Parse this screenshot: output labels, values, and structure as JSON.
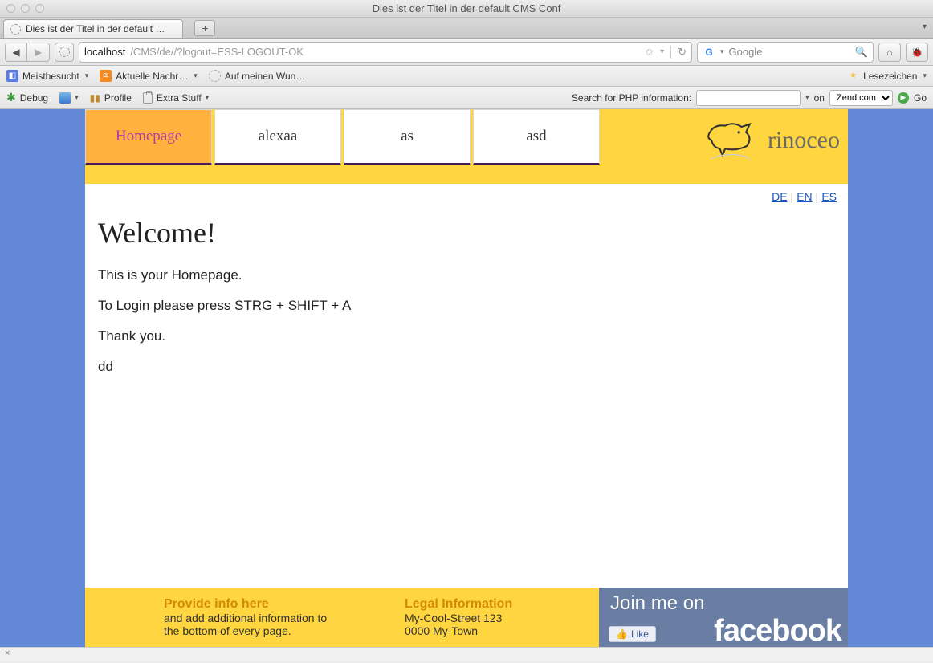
{
  "window": {
    "title": "Dies ist der Titel in der default CMS Conf"
  },
  "tab": {
    "title": "Dies ist der Titel in der default …"
  },
  "url": {
    "host": "localhost",
    "path": "/CMS/de//?logout=ESS-LOGOUT-OK"
  },
  "search": {
    "placeholder": "Google"
  },
  "bookmarks": {
    "most_visited": "Meistbesucht",
    "news": "Aktuelle Nachr…",
    "wishlist": "Auf meinen Wun…",
    "bookmarks_btn": "Lesezeichen"
  },
  "devbar": {
    "debug": "Debug",
    "profile": "Profile",
    "extra": "Extra Stuff",
    "search_label": "Search for PHP information:",
    "on_label": "on",
    "site_select": "Zend.com",
    "go": "Go"
  },
  "nav": {
    "items": [
      "Homepage",
      "alexaa",
      "as",
      "asd"
    ],
    "brand": "rinoceo"
  },
  "lang": {
    "de": "DE",
    "en": "EN",
    "es": "ES"
  },
  "page": {
    "heading": "Welcome!",
    "p1": "This is your Homepage.",
    "p2": "To Login please press STRG + SHIFT + A",
    "p3": "Thank you.",
    "p4": "dd"
  },
  "footer": {
    "info_head": "Provide info here",
    "info_body1": "and add additional information to",
    "info_body2": "the bottom of every page.",
    "legal_head": "Legal Information",
    "legal_l1": "My-Cool-Street 123",
    "legal_l2": "0000 My-Town",
    "fb_join": "Join me on",
    "fb_word": "facebook",
    "fb_like": "Like"
  },
  "statusbar": {
    "text": "×"
  }
}
